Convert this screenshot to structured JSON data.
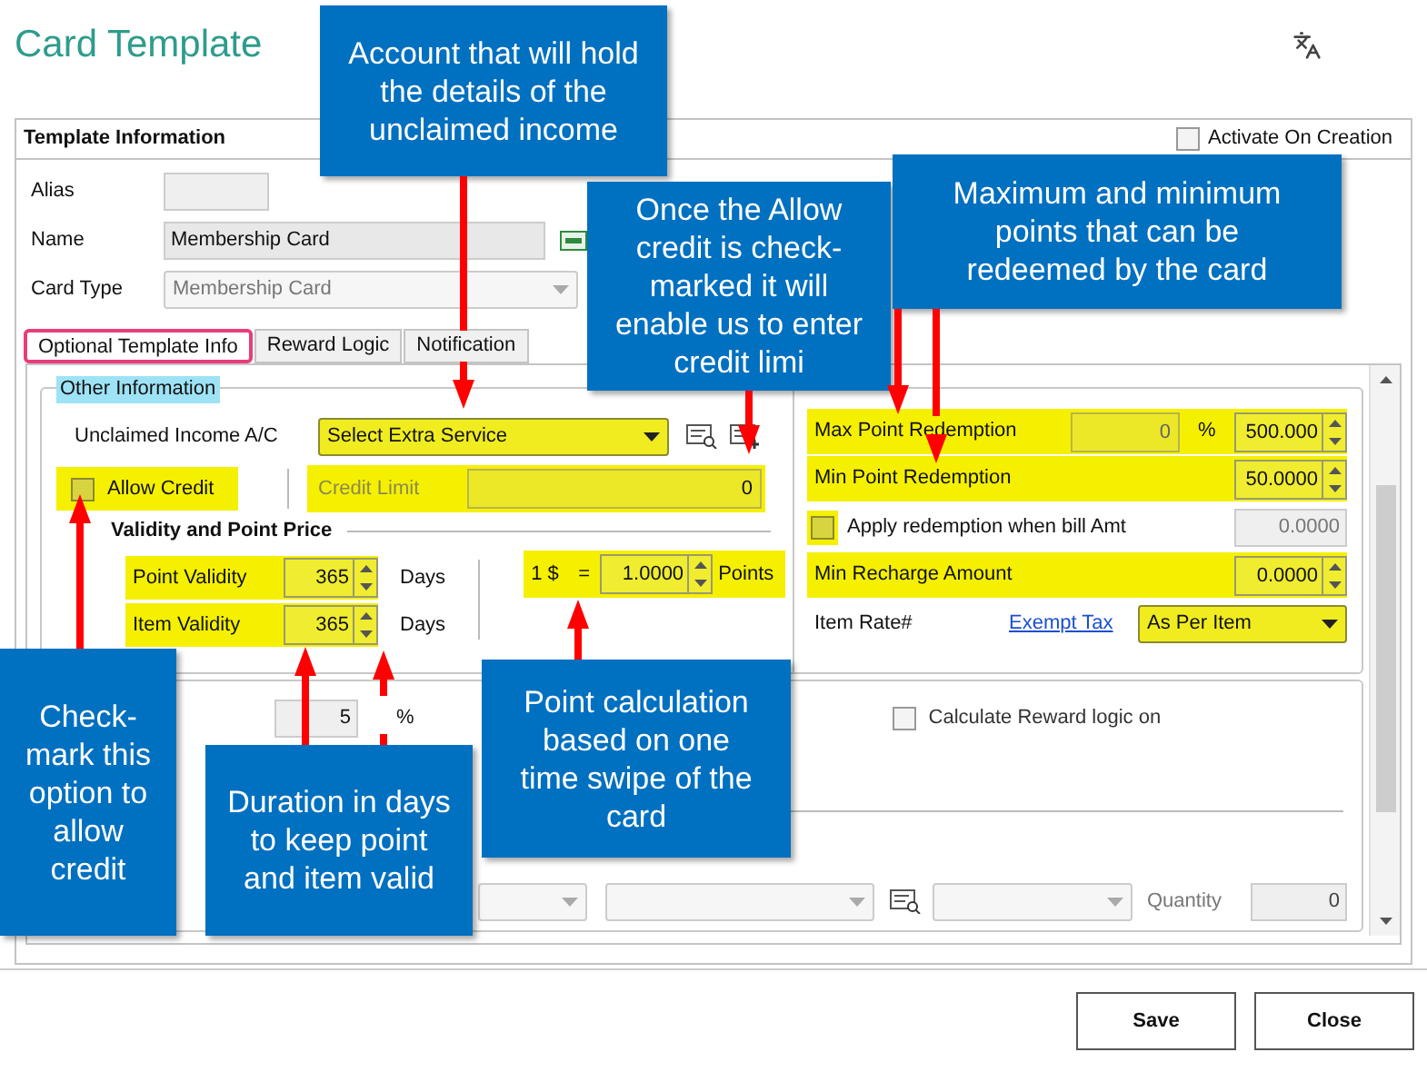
{
  "window": {
    "title": "Card Template"
  },
  "template_information": {
    "title": "Template Information",
    "activate_on_creation": {
      "label": "Activate On Creation",
      "checked": false
    },
    "alias": {
      "label": "Alias"
    },
    "name": {
      "label": "Name",
      "value": "Membership Card"
    },
    "card_type": {
      "label": "Card Type",
      "value": "Membership Card"
    }
  },
  "tabs": [
    {
      "label": "Optional Template Info",
      "selected": true
    },
    {
      "label": "Reward Logic",
      "selected": false
    },
    {
      "label": "Notification",
      "selected": false
    }
  ],
  "other_information": {
    "title": "Other Information",
    "unclaimed_income": {
      "label": "Unclaimed Income A/C",
      "value": "Select Extra Service"
    },
    "allow_credit": {
      "label": "Allow Credit",
      "checked": false
    },
    "credit_limit": {
      "label": "Credit Limit",
      "value": "0",
      "disabled": true
    },
    "validity_title": "Validity and Point Price",
    "point_validity": {
      "label": "Point Validity",
      "value": "365",
      "unit": "Days"
    },
    "item_validity": {
      "label": "Item Validity",
      "value": "365",
      "unit": "Days"
    },
    "point_price": {
      "amount": "1 $",
      "equals": "=",
      "value": "1.0000",
      "unit": "Points"
    },
    "max_point_redemption": {
      "label": "Max Point Redemption",
      "percent": "0",
      "percent_sign": "%",
      "value": "500.000"
    },
    "min_point_redemption": {
      "label": "Min Point Redemption",
      "value": "50.0000"
    },
    "apply_redemption": {
      "label": "Apply redemption when bill Amt",
      "checked": false,
      "value": "0.0000"
    },
    "min_recharge_amount": {
      "label": "Min Recharge Amount",
      "value": "0.0000"
    },
    "item_rate": {
      "label": "Item Rate#",
      "link": "Exempt Tax",
      "value": "As Per Item"
    }
  },
  "reward_section": {
    "discount_value": "5",
    "percent_sign": "%",
    "calculate_reward": {
      "label": "Calculate Reward logic on",
      "checked": false
    },
    "quantity": {
      "label": "Quantity",
      "value": "0"
    }
  },
  "callouts": [
    {
      "text": "Account that will hold the details of the unclaimed income"
    },
    {
      "text": "Once the Allow credit is check-marked it will enable us to enter credit limi"
    },
    {
      "text": "Maximum and minimum points that can be redeemed by the card"
    },
    {
      "text": "Check-mark this option to allow credit"
    },
    {
      "text": "Duration in days to keep point and item valid"
    },
    {
      "text": "Point calculation based on one time swipe of the card"
    }
  ],
  "buttons": [
    {
      "label": "Save"
    },
    {
      "label": "Close"
    }
  ]
}
